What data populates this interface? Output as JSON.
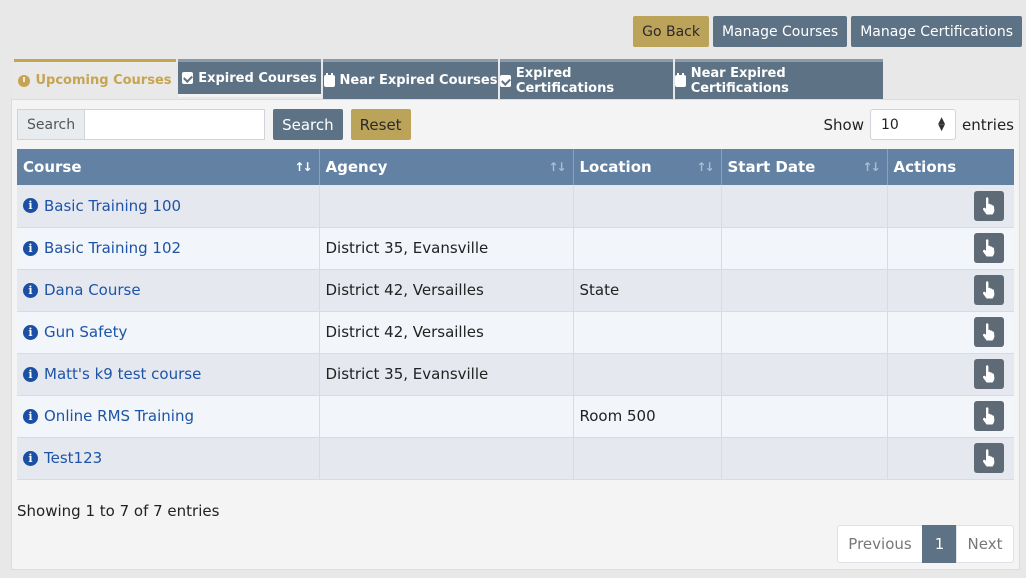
{
  "header": {
    "go_back_label": "Go Back",
    "manage_courses_label": "Manage Courses",
    "manage_certifications_label": "Manage Certifications"
  },
  "tabs": [
    {
      "label": "Upcoming Courses",
      "icon": "clock-icon",
      "active": true
    },
    {
      "label": "Expired Courses",
      "icon": "calendar-check-icon",
      "active": false
    },
    {
      "label": "Near Expired Courses",
      "icon": "calendar-icon",
      "active": false
    },
    {
      "label": "Expired Certifications",
      "icon": "calendar-check-icon",
      "active": false
    },
    {
      "label": "Near Expired Certifications",
      "icon": "calendar-icon",
      "active": false
    }
  ],
  "search": {
    "label": "Search",
    "value": "",
    "button_label": "Search",
    "reset_label": "Reset"
  },
  "length": {
    "show_label": "Show",
    "value": "10",
    "entries_label": "entries"
  },
  "table": {
    "columns": [
      "Course",
      "Agency",
      "Location",
      "Start Date",
      "Actions"
    ],
    "rows": [
      {
        "course": "Basic Training 100",
        "agency": "",
        "location": "",
        "start_date": ""
      },
      {
        "course": "Basic Training 102",
        "agency": "District 35, Evansville",
        "location": "",
        "start_date": ""
      },
      {
        "course": "Dana Course",
        "agency": "District 42, Versailles",
        "location": "State",
        "start_date": ""
      },
      {
        "course": "Gun Safety",
        "agency": "District 42, Versailles",
        "location": "",
        "start_date": ""
      },
      {
        "course": "Matt's k9 test course",
        "agency": "District 35, Evansville",
        "location": "",
        "start_date": ""
      },
      {
        "course": "Online RMS Training",
        "agency": "",
        "location": "Room 500",
        "start_date": ""
      },
      {
        "course": "Test123",
        "agency": "",
        "location": "",
        "start_date": ""
      }
    ]
  },
  "info": "Showing 1 to 7 of 7 entries",
  "pagination": {
    "previous_label": "Previous",
    "page": "1",
    "next_label": "Next"
  },
  "colors": {
    "accent_gold": "#bca35a",
    "slate": "#5d7385",
    "header_blue": "#6382a3",
    "link_blue": "#1d54a6"
  }
}
